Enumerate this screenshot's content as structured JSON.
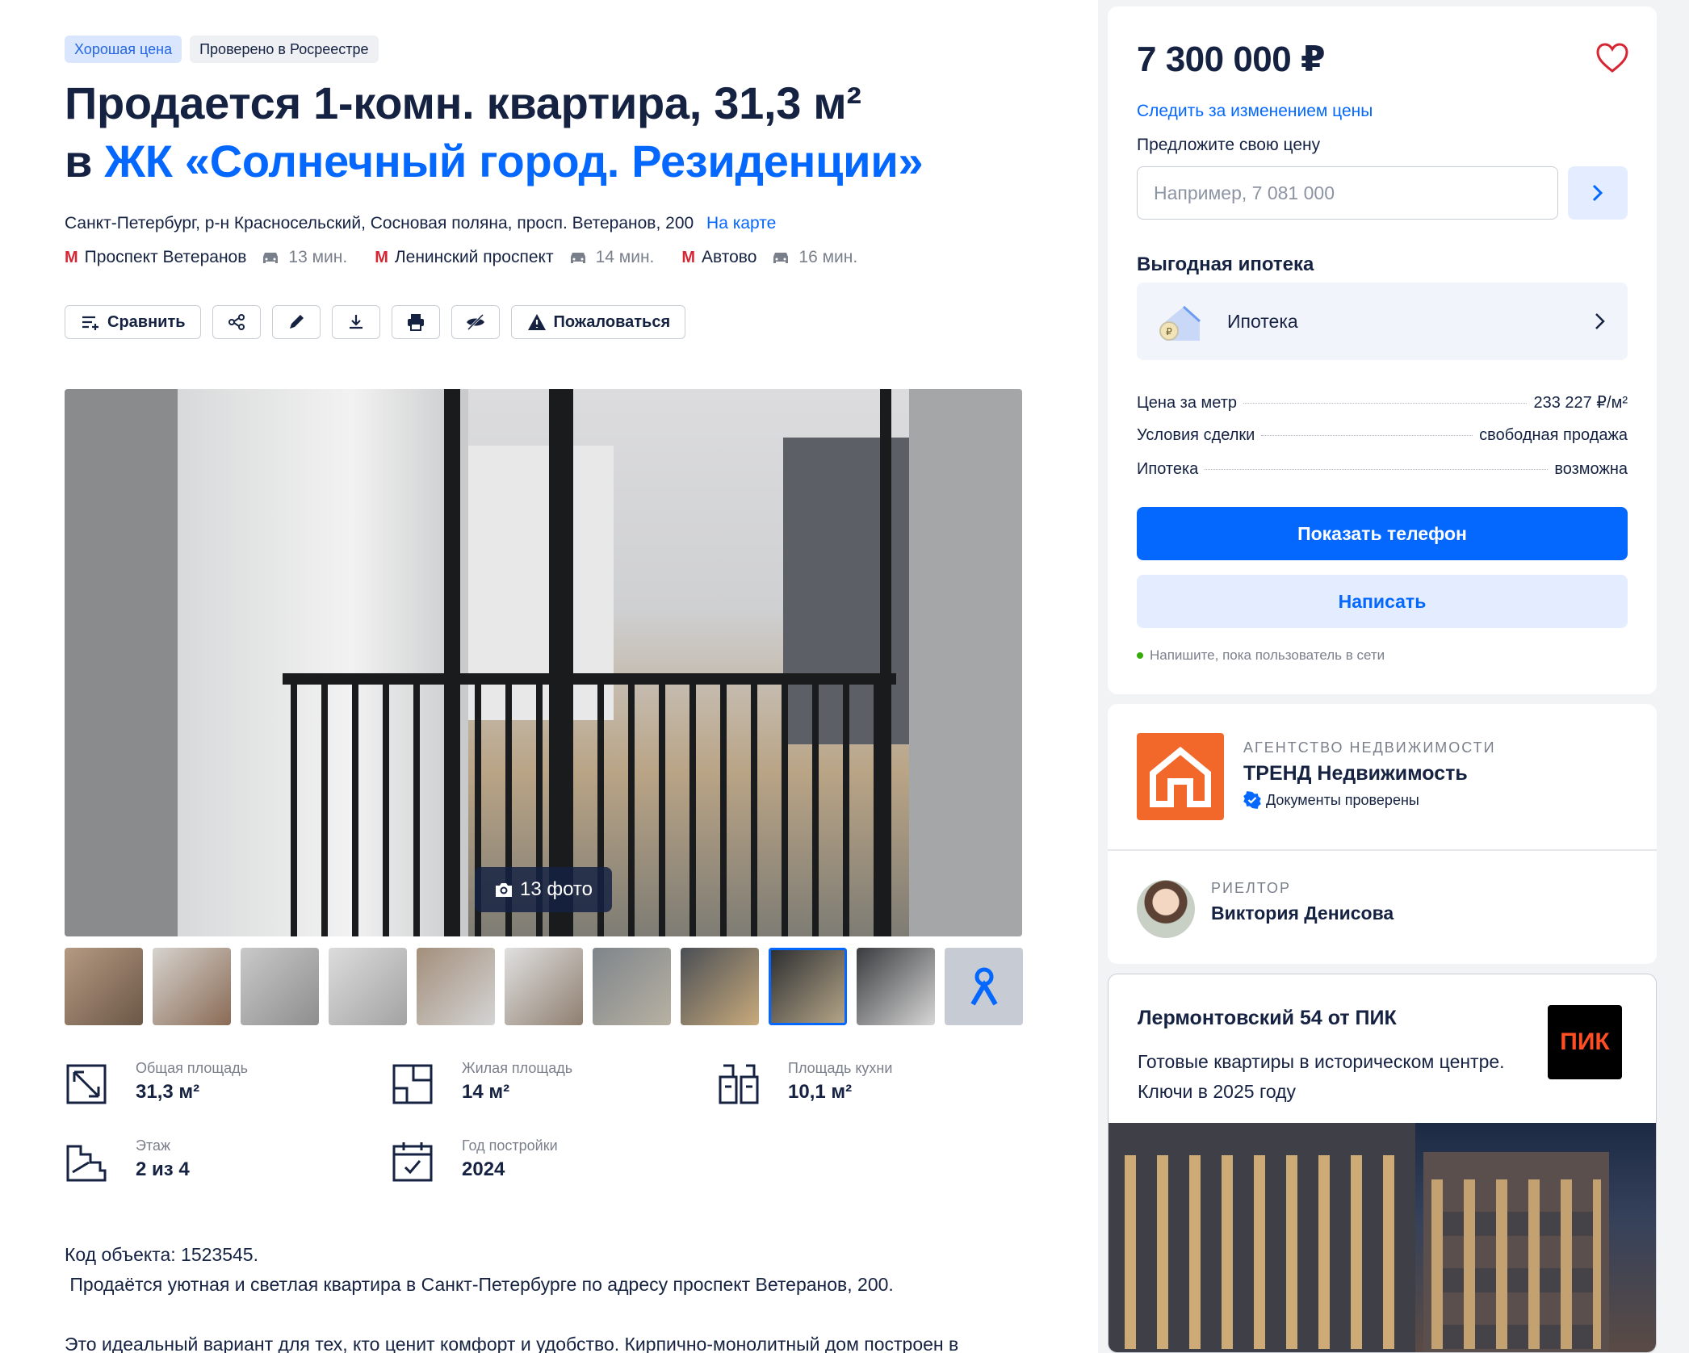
{
  "badges": {
    "good_price": "Хорошая цена",
    "verified_registry": "Проверено в Росреестре"
  },
  "title": {
    "line1": "Продается 1-комн. квартира, 31,3 м²",
    "prefix": "в",
    "complex": "ЖК «Солнечный город. Резиденции»"
  },
  "address": {
    "text": "Санкт-Петербург, р-н Красносельский, Сосновая поляна, просп. Ветеранов, 200",
    "map_link": "На карте"
  },
  "metro": [
    {
      "station": "Проспект Ветеранов",
      "time": "13 мин."
    },
    {
      "station": "Ленинский проспект",
      "time": "14 мин."
    },
    {
      "station": "Автово",
      "time": "16 мин."
    }
  ],
  "toolbar": {
    "compare": "Сравнить",
    "complain": "Пожаловаться"
  },
  "gallery": {
    "counter": "13 фото",
    "selected_thumb": 9
  },
  "params": {
    "total_area": {
      "label": "Общая площадь",
      "value": "31,3 м²"
    },
    "living_area": {
      "label": "Жилая площадь",
      "value": "14 м²"
    },
    "kitchen_area": {
      "label": "Площадь кухни",
      "value": "10,1 м²"
    },
    "floor": {
      "label": "Этаж",
      "value": "2 из 4"
    },
    "year": {
      "label": "Год постройки",
      "value": "2024"
    }
  },
  "description": {
    "line1": "Код объекта: 1523545.",
    "line2": " Продаётся уютная и светлая квартира в Санкт-Петербурге по адресу проспект Ветеранов, 200.",
    "line3": "Это идеальный вариант для тех, кто ценит комфорт и удобство. Кирпично-монолитный дом построен в"
  },
  "price_card": {
    "price": "7 300 000 ₽",
    "track": "Следить за изменением цены",
    "offer_label": "Предложите свою цену",
    "offer_placeholder": "Например, 7 081 000",
    "mortgage_header": "Выгодная ипотека",
    "mortgage_button": "Ипотека",
    "facts": [
      {
        "label": "Цена за метр",
        "value": "233 227 ₽/м²"
      },
      {
        "label": "Условия сделки",
        "value": "свободная продажа"
      },
      {
        "label": "Ипотека",
        "value": "возможна"
      }
    ],
    "show_phone": "Показать телефон",
    "write": "Написать",
    "online": "Напишите, пока пользователь в сети"
  },
  "agency": {
    "type": "АГЕНТСТВО НЕДВИЖИМОСТИ",
    "name": "ТРЕНД Недвижимость",
    "verified": "Документы проверены",
    "realtor_type": "РИЕЛТОР",
    "realtor_name": "Виктория Денисова"
  },
  "ad": {
    "title": "Лермонтовский 54 от ПИК",
    "text": "Готовые квартиры в историческом центре. Ключи в 2025 году",
    "logo": "ПИК"
  },
  "colors": {
    "accent": "#0468ff",
    "text": "#152242",
    "muted": "#7a7f8c",
    "metro": "#d72633",
    "agency": "#f2672a"
  }
}
